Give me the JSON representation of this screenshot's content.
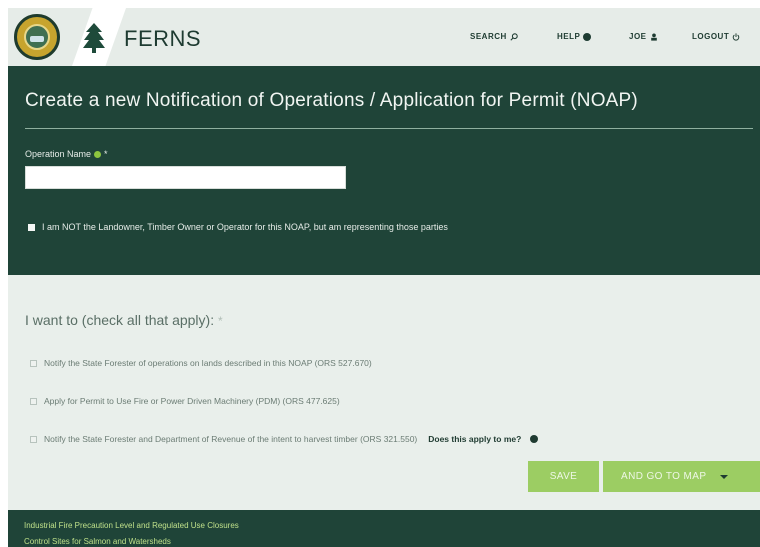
{
  "header": {
    "brand": "FERNS",
    "nav": {
      "search": "SEARCH",
      "help": "HELP",
      "user": "JOE",
      "logout": "LOGOUT"
    }
  },
  "form": {
    "title": "Create a new Notification of Operations / Application for Permit (NOAP)",
    "operation_name": {
      "label": "Operation Name",
      "required_marker": "*",
      "value": "",
      "placeholder": ""
    },
    "representing_label": "I am NOT the Landowner, Timber Owner or Operator for this NOAP, but am representing those parties"
  },
  "options": {
    "heading": "I want to (check all that apply):",
    "required_marker": "*",
    "items": [
      {
        "label": "Notify the State Forester of operations on lands described in this NOAP (ORS 527.670)",
        "checked": false
      },
      {
        "label": "Apply for Permit to Use Fire or Power Driven Machinery (PDM) (ORS 477.625)",
        "checked": false
      },
      {
        "label": "Notify the State Forester and Department of Revenue of the intent to harvest timber (ORS 321.550)",
        "checked": false
      }
    ],
    "applies_link": "Does this apply to me?"
  },
  "actions": {
    "save": "SAVE",
    "save_map": "AND GO TO MAP"
  },
  "footer": {
    "links": [
      "Industrial Fire Precaution Level and Regulated Use Closures",
      "Control Sites for Salmon and Watersheds"
    ]
  },
  "colors": {
    "header_bg": "#e6ece8",
    "panel_bg": "#1f4438",
    "accent_green": "#9ccd63",
    "info_green": "#8dc63f",
    "options_bg": "#e9efeb"
  }
}
